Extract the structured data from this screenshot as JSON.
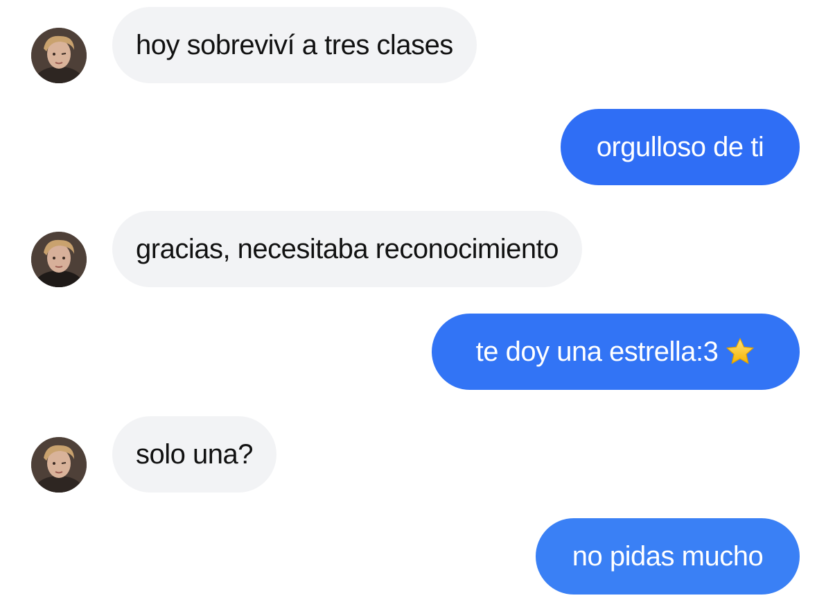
{
  "messages": [
    {
      "side": "in",
      "text": "hoy sobreviví a tres clases"
    },
    {
      "side": "out",
      "text": "orgulloso de ti",
      "color": "#2f6ef5"
    },
    {
      "side": "in",
      "text": "gracias, necesitaba reconocimiento"
    },
    {
      "side": "out",
      "text": "te doy una estrella:3",
      "emoji": "star-icon",
      "color": "#3274f5"
    },
    {
      "side": "in",
      "text": "solo una?"
    },
    {
      "side": "out",
      "text": "no pidas mucho",
      "color": "#3a80f5"
    }
  ],
  "colors": {
    "incoming_bubble": "#f2f3f5",
    "incoming_text": "#111111",
    "outgoing_text": "#ffffff"
  }
}
